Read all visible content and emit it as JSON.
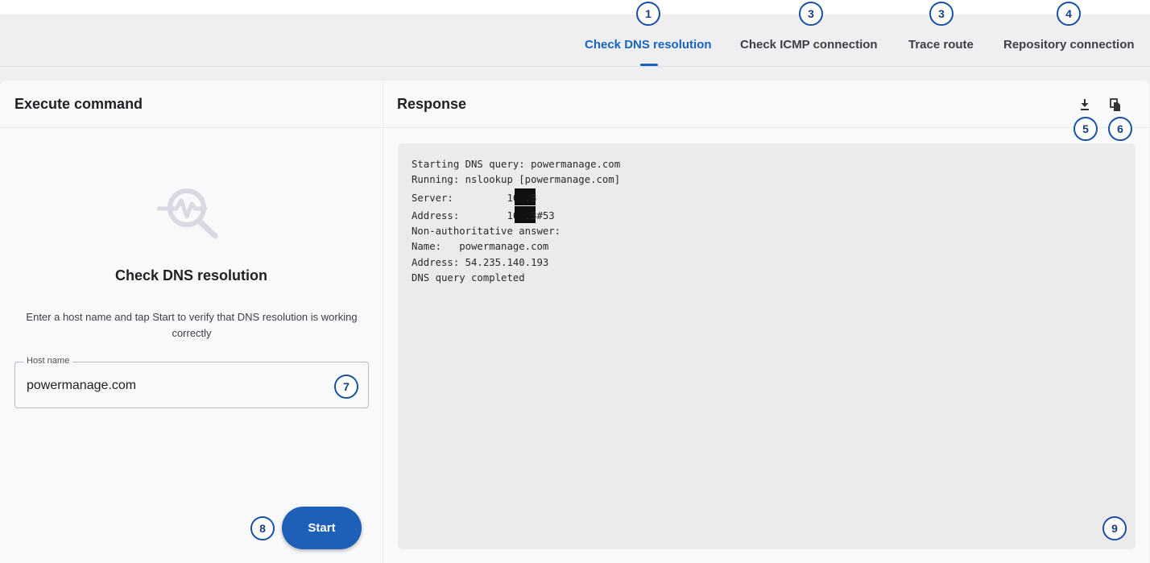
{
  "tabs": [
    {
      "label": "Check DNS resolution",
      "active": true
    },
    {
      "label": "Check ICMP connection",
      "active": false
    },
    {
      "label": "Trace route",
      "active": false
    },
    {
      "label": "Repository connection",
      "active": false
    }
  ],
  "left_panel": {
    "title": "Execute command",
    "section_title": "Check DNS resolution",
    "description": "Enter a host name and tap Start to verify that DNS resolution is working correctly",
    "host_field": {
      "label": "Host name",
      "value": "powermanage.com"
    },
    "start_label": "Start",
    "empty_icon": "network-search-icon"
  },
  "right_panel": {
    "title": "Response",
    "download_icon": "download-icon",
    "copy_icon": "copy-icon",
    "lines": {
      "l1": "Starting DNS query: powermanage.com",
      "l2": "Running: nslookup [powermanage.com]",
      "l3a": "Server:         10.",
      "l3b": ".3",
      "l4a": "Address:        10.",
      "l4b": ".3#53",
      "l5": "Non-authoritative answer:",
      "l6": "Name:   powermanage.com",
      "l7": "Address: 54.235.140.193",
      "l8": "DNS query completed"
    }
  },
  "annotations": {
    "b1": "1",
    "b3a": "3",
    "b3b": "3",
    "b4": "4",
    "b5": "5",
    "b6": "6",
    "b7": "7",
    "b8": "8",
    "b9": "9"
  },
  "colors": {
    "accent": "#1565c0",
    "button": "#1e5fb8",
    "badge_border": "#1a4fa8"
  }
}
